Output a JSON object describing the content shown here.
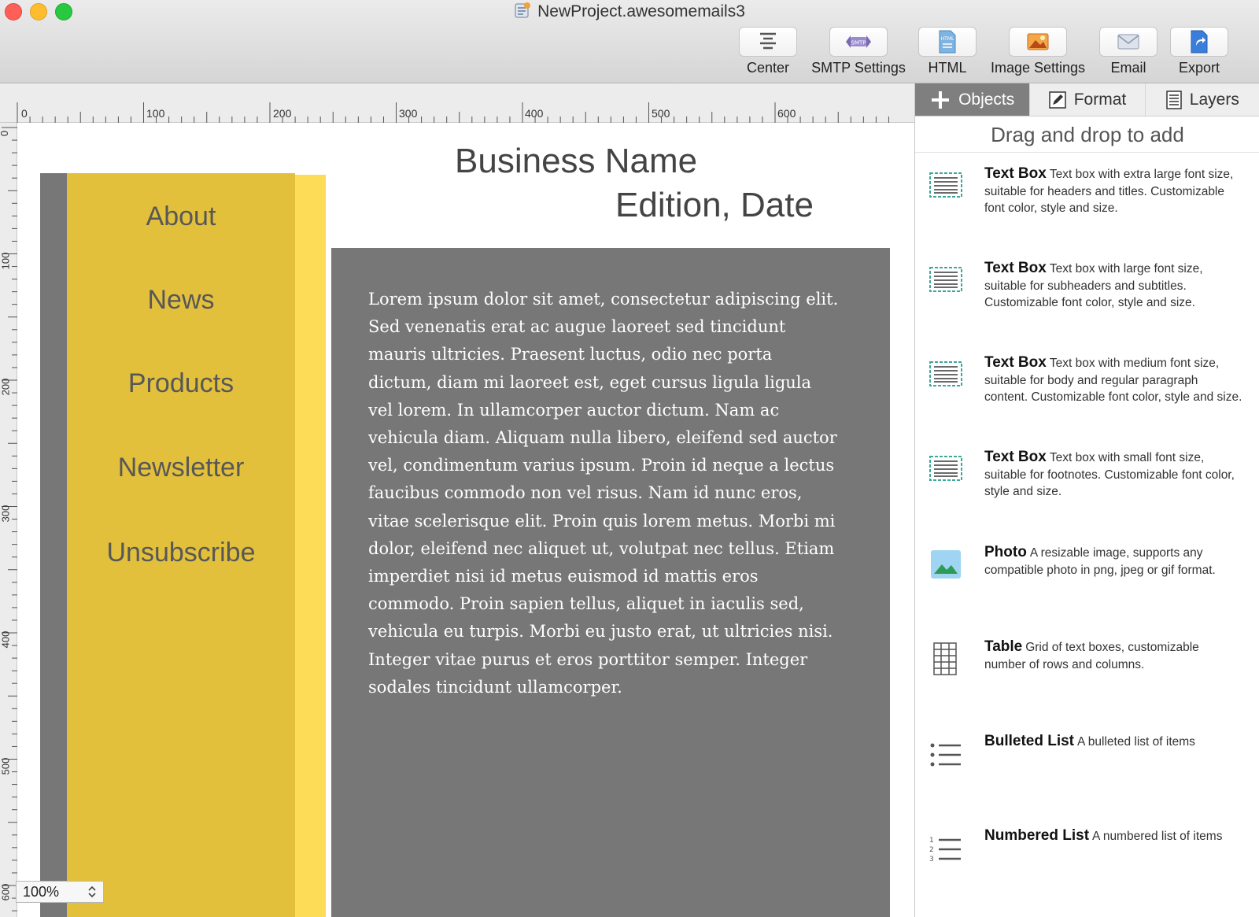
{
  "window": {
    "title": "NewProject.awesomemails3"
  },
  "toolbar": {
    "center": "Center",
    "smtp": "SMTP Settings",
    "html": "HTML",
    "image": "Image Settings",
    "email": "Email",
    "export": "Export"
  },
  "ruler": {
    "top": [
      "0",
      "100",
      "200",
      "300",
      "400",
      "500",
      "600"
    ],
    "left": [
      "0",
      "100",
      "200",
      "300",
      "400",
      "500",
      "600"
    ]
  },
  "canvas": {
    "nav": [
      "About",
      "News",
      "Products",
      "Newsletter",
      "Unsubscribe"
    ],
    "business_name": "Business Name",
    "edition": "Edition, Date",
    "body_text": "Lorem ipsum dolor sit amet, consectetur adipiscing elit. Sed venenatis erat ac augue laoreet sed tincidunt mauris ultricies. Praesent luctus, odio nec porta dictum, diam mi laoreet est, eget cursus ligula ligula vel lorem. In ullamcorper auctor dictum. Nam ac vehicula diam. Aliquam nulla libero, eleifend sed auctor vel, condimentum varius ipsum. Proin id neque a lectus faucibus commodo non vel risus. Nam id nunc eros, vitae scelerisque elit. Proin quis lorem metus. Morbi mi dolor, eleifend nec aliquet ut, volutpat nec tellus. Etiam imperdiet nisi id metus euismod id mattis eros commodo. Proin sapien tellus, aliquet in iaculis sed, vehicula eu turpis. Morbi eu justo erat, ut ultricies nisi. Integer vitae purus et eros porttitor semper. Integer sodales tincidunt ullamcorper."
  },
  "zoom": {
    "value": "100%"
  },
  "panel": {
    "tabs": {
      "objects": "Objects",
      "format": "Format",
      "layers": "Layers"
    },
    "header": "Drag and drop to add",
    "objects": [
      {
        "name": "Text Box",
        "desc": "Text box with extra large font size, suitable for headers and titles. Customizable font color, style and size.",
        "icon": "textbox-icon"
      },
      {
        "name": "Text Box",
        "desc": "Text box with large font size, suitable for subheaders and subtitles. Customizable font color, style and size.",
        "icon": "textbox-icon"
      },
      {
        "name": "Text Box",
        "desc": "Text box with medium font size, suitable for body and regular paragraph content. Customizable font color, style and size.",
        "icon": "textbox-icon"
      },
      {
        "name": "Text Box",
        "desc": "Text box with small font size, suitable for footnotes. Customizable font color, style and size.",
        "icon": "textbox-icon"
      },
      {
        "name": "Photo",
        "desc": "A resizable image, supports any compatible photo in png, jpeg or gif format.",
        "icon": "photo-icon"
      },
      {
        "name": "Table",
        "desc": "Grid of text boxes, customizable number of rows and columns.",
        "icon": "table-icon"
      },
      {
        "name": "Bulleted List",
        "desc": "A bulleted list of items",
        "icon": "bulleted-list-icon"
      },
      {
        "name": "Numbered List",
        "desc": "A numbered list of items",
        "icon": "numbered-list-icon"
      }
    ]
  },
  "colors": {
    "nav_yellow": "#e3c03c",
    "nav_light": "#fddc57",
    "content_gray": "#777777",
    "tab_active": "#7f7f7f",
    "icon_teal": "#3aa99a"
  }
}
